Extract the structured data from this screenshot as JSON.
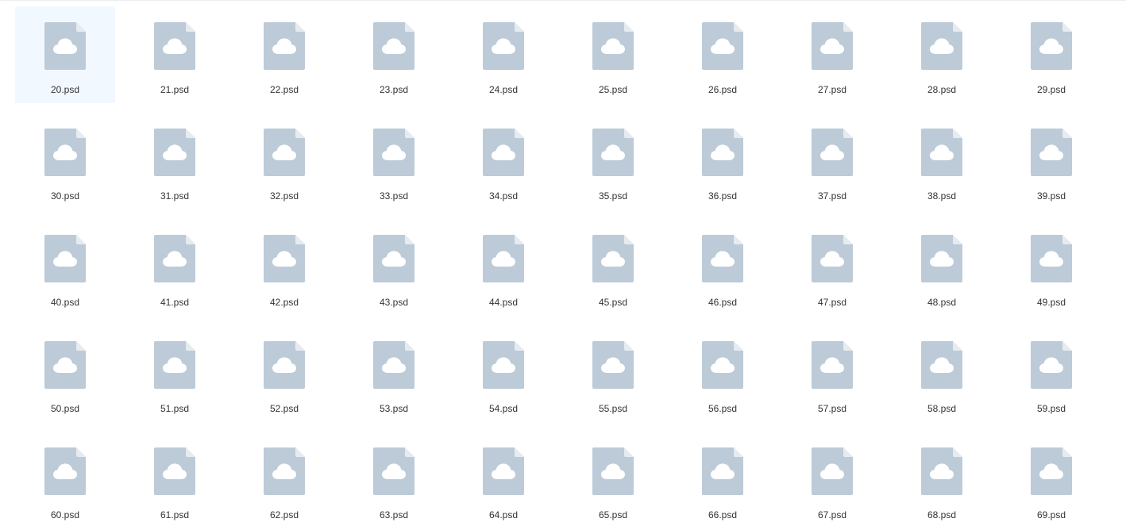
{
  "colors": {
    "file_icon": "#bccbd7",
    "file_icon_fold": "#e6ebf0",
    "cloud": "#ffffff",
    "selected_background": "#f1f8ff",
    "label_text": "#333333"
  },
  "icon": "cloud-file-icon",
  "selected_index": 0,
  "files": [
    {
      "name": "20.psd"
    },
    {
      "name": "21.psd"
    },
    {
      "name": "22.psd"
    },
    {
      "name": "23.psd"
    },
    {
      "name": "24.psd"
    },
    {
      "name": "25.psd"
    },
    {
      "name": "26.psd"
    },
    {
      "name": "27.psd"
    },
    {
      "name": "28.psd"
    },
    {
      "name": "29.psd"
    },
    {
      "name": "30.psd"
    },
    {
      "name": "31.psd"
    },
    {
      "name": "32.psd"
    },
    {
      "name": "33.psd"
    },
    {
      "name": "34.psd"
    },
    {
      "name": "35.psd"
    },
    {
      "name": "36.psd"
    },
    {
      "name": "37.psd"
    },
    {
      "name": "38.psd"
    },
    {
      "name": "39.psd"
    },
    {
      "name": "40.psd"
    },
    {
      "name": "41.psd"
    },
    {
      "name": "42.psd"
    },
    {
      "name": "43.psd"
    },
    {
      "name": "44.psd"
    },
    {
      "name": "45.psd"
    },
    {
      "name": "46.psd"
    },
    {
      "name": "47.psd"
    },
    {
      "name": "48.psd"
    },
    {
      "name": "49.psd"
    },
    {
      "name": "50.psd"
    },
    {
      "name": "51.psd"
    },
    {
      "name": "52.psd"
    },
    {
      "name": "53.psd"
    },
    {
      "name": "54.psd"
    },
    {
      "name": "55.psd"
    },
    {
      "name": "56.psd"
    },
    {
      "name": "57.psd"
    },
    {
      "name": "58.psd"
    },
    {
      "name": "59.psd"
    },
    {
      "name": "60.psd"
    },
    {
      "name": "61.psd"
    },
    {
      "name": "62.psd"
    },
    {
      "name": "63.psd"
    },
    {
      "name": "64.psd"
    },
    {
      "name": "65.psd"
    },
    {
      "name": "66.psd"
    },
    {
      "name": "67.psd"
    },
    {
      "name": "68.psd"
    },
    {
      "name": "69.psd"
    }
  ]
}
